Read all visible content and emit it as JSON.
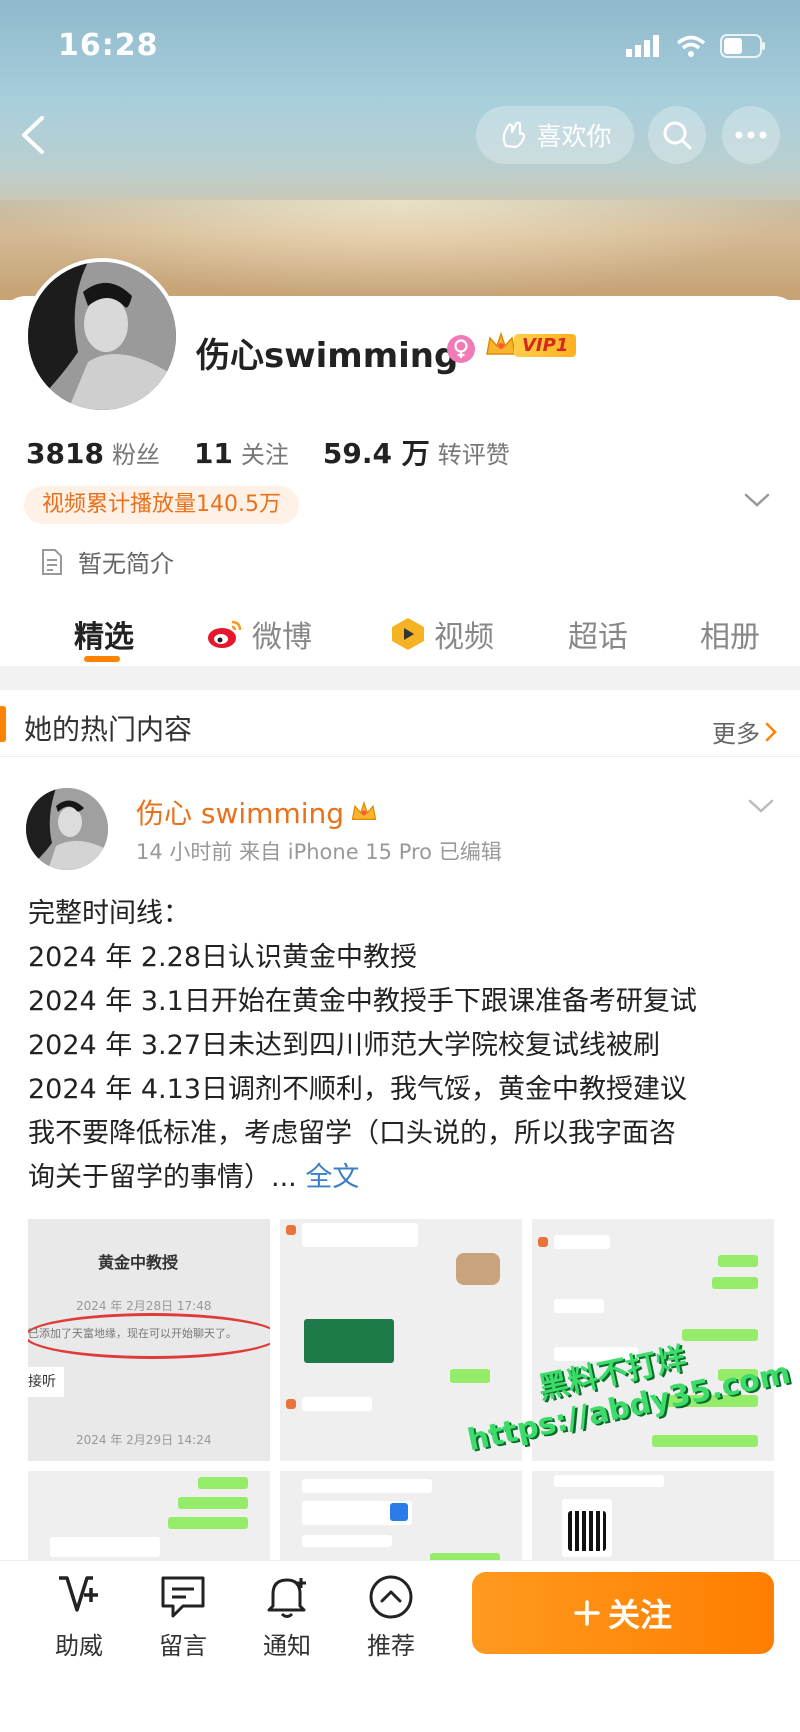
{
  "status_bar": {
    "time": "16:28"
  },
  "header": {
    "like_label": "喜欢你",
    "icons": [
      "back-arrow-icon",
      "heart-hand-icon",
      "search-icon",
      "more-icon"
    ]
  },
  "profile": {
    "name": "伤心swimming",
    "vip_label": "VIP1",
    "stats": [
      {
        "value": "3818",
        "label": "粉丝"
      },
      {
        "value": "11",
        "label": "关注"
      },
      {
        "value": "59.4 万",
        "label": "转评赞"
      }
    ],
    "video_tag": "视频累计播放量140.5万",
    "intro": "暂无简介"
  },
  "tabs": [
    {
      "label": "精选",
      "active": true
    },
    {
      "label": "微博",
      "icon": "weibo-icon"
    },
    {
      "label": "视频",
      "icon": "video-icon"
    },
    {
      "label": "超话"
    },
    {
      "label": "相册"
    }
  ],
  "hot": {
    "title": "她的热门内容",
    "more": "更多"
  },
  "post": {
    "author": "伤心 swimming",
    "meta": "14 小时前  来自 iPhone 15 Pro  已编辑",
    "lines": [
      "完整时间线：",
      "2024 年 2.28日认识黄金中教授",
      "2024 年 3.1日开始在黄金中教授手下跟课准备考研复试",
      "2024 年 3.27日未达到四川师范大学院校复试线被刷",
      "2024 年 4.13日调剂不顺利，我气馁，黄金中教授建议",
      "我不要降低标准，考虑留学（口头说的，所以我字面咨",
      "询关于留学的事情）..."
    ],
    "more_link": "全文",
    "images": {
      "img1_title": "黄金中教授",
      "img1_date1": "2024 年 2月28日 17:48",
      "img1_msg": "已添加了天富地缘，现在可以开始聊天了。",
      "img1_side": "接听",
      "img1_date2": "2024 年 2月29日 14:24"
    }
  },
  "watermark": {
    "line1": "黑料不打烊",
    "line2": "https://abdy35.com"
  },
  "bottom_bar": {
    "items": [
      {
        "label": "助威",
        "icon": "cheer-icon"
      },
      {
        "label": "留言",
        "icon": "message-icon"
      },
      {
        "label": "通知",
        "icon": "bell-icon"
      },
      {
        "label": "推荐",
        "icon": "recommend-icon"
      }
    ],
    "follow_label": "关注"
  },
  "colors": {
    "accent": "#ff8200",
    "link": "#3b7fc4",
    "tag_bg": "#fff1e6"
  }
}
